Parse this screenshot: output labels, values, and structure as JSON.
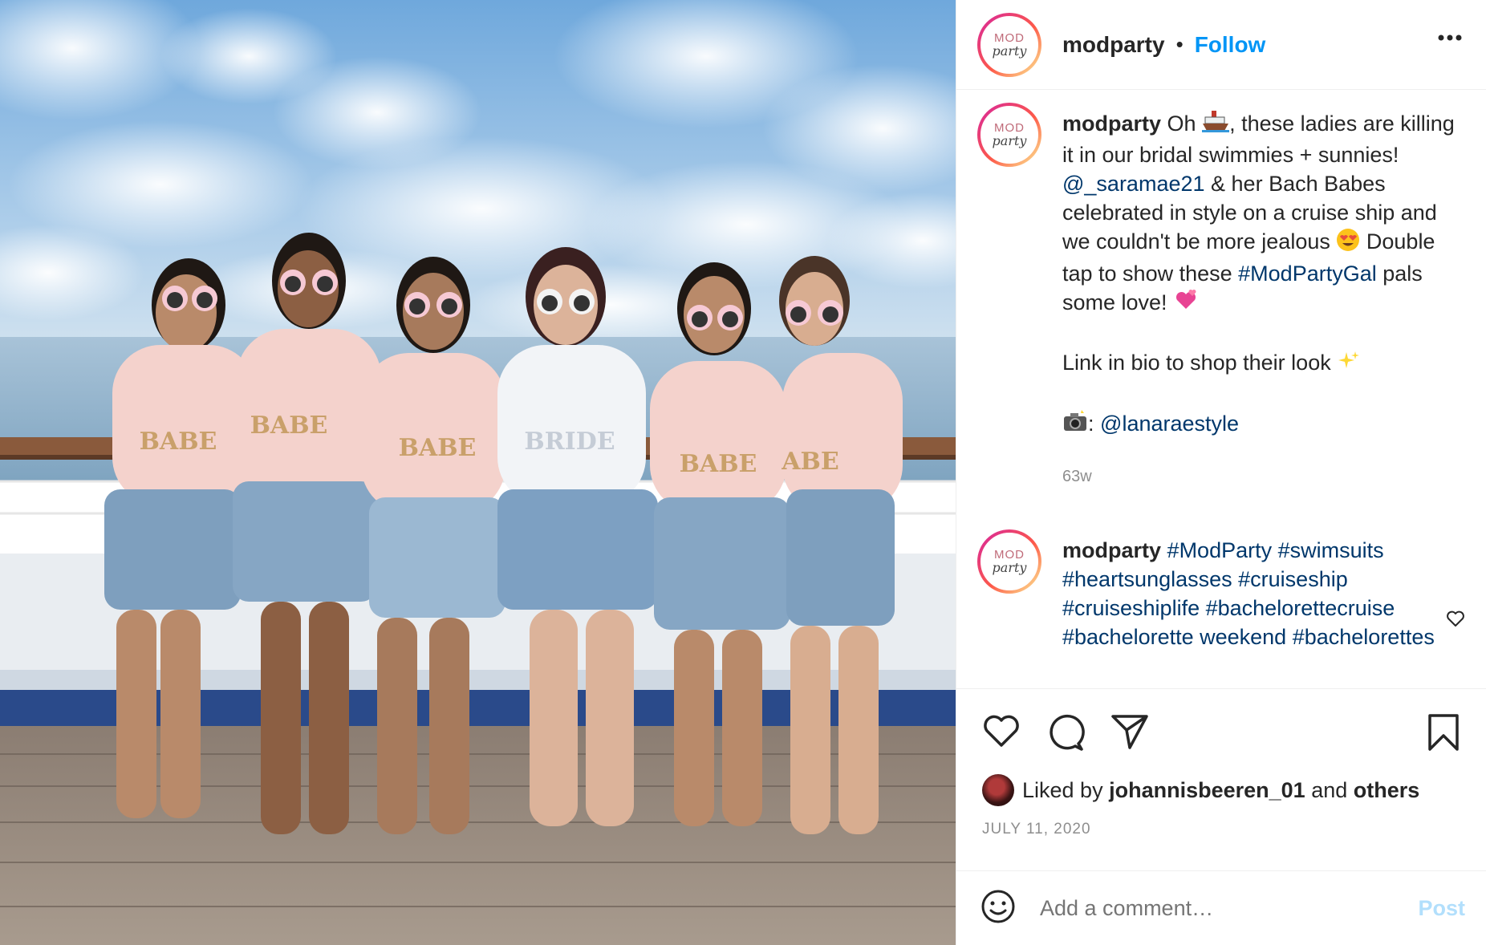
{
  "post": {
    "username": "modparty",
    "follow_label": "Follow",
    "separator": "•",
    "avatar_text_top": "MOD",
    "avatar_text_bottom": "party",
    "caption": {
      "p1": "Oh",
      "p2": ", these ladies are killing it in our bridal swimmies + sunnies!",
      "mention1": "@_saramae21",
      "p3": "& her Bach Babes celebrated in style on a cruise ship and we couldn't be more jealous",
      "p4": "Double tap to show these",
      "hashtag1": "#ModPartyGal",
      "p5": "pals some love!",
      "p6": "Link in bio to shop their look",
      "p7": ":",
      "mention2": "@lanaraestyle"
    },
    "caption_icons": [
      "ship-emoji",
      "heart-eyes-emoji",
      "two-hearts-emoji",
      "sparkles-emoji",
      "camera-flash-emoji"
    ],
    "time_ago": "63w",
    "comment": {
      "username": "modparty",
      "hashtags": [
        "#ModParty",
        "#swimsuits",
        "#heartsunglasses",
        "#cruiseship",
        "#cruiseshiplife",
        "#bachelorettecruise",
        "#bachelorette weekend",
        "#bachelorettes"
      ]
    },
    "liked_by": {
      "prefix": "Liked by",
      "user": "johannisbeeren_01",
      "and": "and",
      "others": "others"
    },
    "date": "JULY 11, 2020",
    "add_comment_placeholder": "Add a comment…",
    "post_label": "Post",
    "shirt_labels": [
      "BABE",
      "BABE",
      "BABE",
      "BRIDE",
      "BABE",
      "ABE"
    ],
    "colors": {
      "accent": "#0095f6",
      "link": "#00376b",
      "muted": "#8e8e8e",
      "post_disabled": "#b2dffc"
    }
  }
}
